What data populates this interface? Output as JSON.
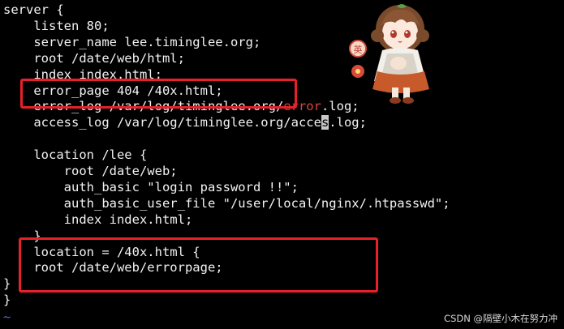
{
  "editor": {
    "lines": [
      "server {",
      "    listen 80;",
      "    server_name lee.timinglee.org;",
      "    root /date/web/html;",
      "    index index.html;",
      "    error_page 404 /40x.html;",
      "    error_log /var/log/timinglee.org/",
      "error",
      ".log;",
      "    access_log /var/log/timinglee.org/acce",
      "s",
      ".log;",
      "",
      "    location /lee {",
      "        root /date/web;",
      "        auth_basic \"login password !!\";",
      "        auth_basic_user_file \"/user/local/nginx/.htpasswd\";",
      "        index index.html;",
      "    }",
      "    location = /40x.html {",
      "    root /date/web/errorpage;",
      "}",
      "}"
    ],
    "tilde": "~"
  },
  "annotation_color": "#e8202a",
  "keyword_color": "#e0433a",
  "watermark": "CSDN @隔壁小木在努力冲",
  "sticker_text": "英"
}
